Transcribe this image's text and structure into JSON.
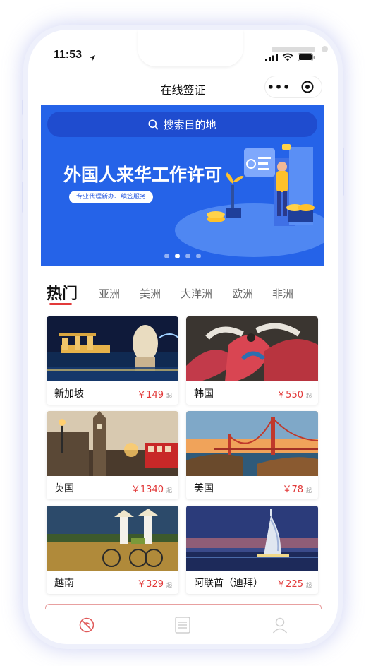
{
  "status_bar": {
    "time": "11:53"
  },
  "nav": {
    "title": "在线签证",
    "more_label": "•••"
  },
  "search": {
    "placeholder": "搜索目的地"
  },
  "banner": {
    "headline": "外国人来华工作许可",
    "tagline": "专业代理新办、续签服务",
    "slide_count": 4,
    "active_slide": 2
  },
  "tabs": [
    {
      "label": "热门",
      "active": true
    },
    {
      "label": "亚洲"
    },
    {
      "label": "美洲"
    },
    {
      "label": "大洋洲"
    },
    {
      "label": "欧洲"
    },
    {
      "label": "非洲"
    }
  ],
  "destinations": [
    {
      "name": "新加坡",
      "price": "￥149",
      "suffix": "起"
    },
    {
      "name": "韩国",
      "price": "￥550",
      "suffix": "起"
    },
    {
      "name": "英国",
      "price": "￥1340",
      "suffix": "起"
    },
    {
      "name": "美国",
      "price": "￥78",
      "suffix": "起"
    },
    {
      "name": "越南",
      "price": "￥329",
      "suffix": "起"
    },
    {
      "name": "阿联酋（迪拜）",
      "price": "￥225",
      "suffix": "起"
    }
  ],
  "tabbar": {
    "items": [
      {
        "icon": "visa-icon",
        "active": true
      },
      {
        "icon": "orders-list-icon",
        "active": false
      },
      {
        "icon": "profile-icon",
        "active": false
      }
    ]
  },
  "colors": {
    "accent": "#e23a3a",
    "banner": "#2563e8"
  }
}
